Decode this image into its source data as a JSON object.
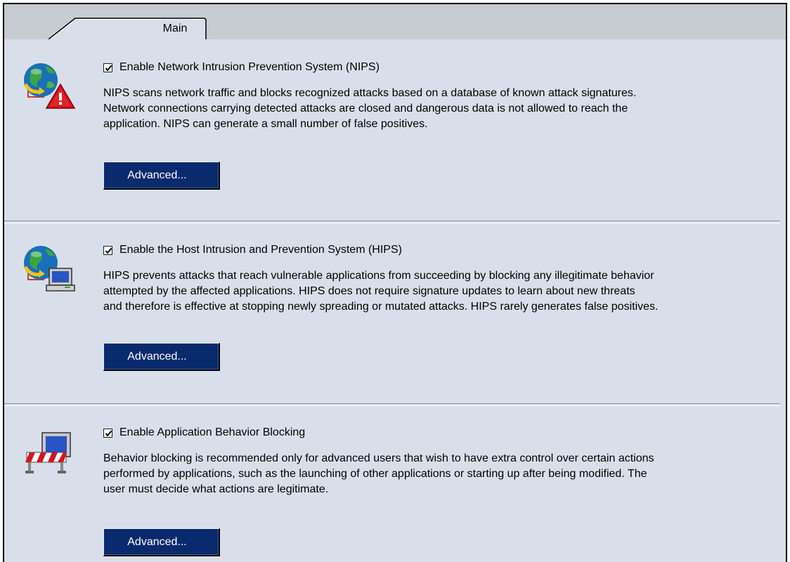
{
  "tabs": [
    {
      "label": "Main",
      "active": true
    }
  ],
  "sections": [
    {
      "id": "nips",
      "icon": "globe-warning-icon",
      "checkbox_checked": true,
      "checkbox_label": "Enable Network Intrusion Prevention System (NIPS)",
      "description_lines": [
        "NIPS scans network traffic and blocks recognized attacks based on a database of known attack signatures.",
        "Network connections carrying detected attacks are closed and dangerous data is not allowed to reach the",
        "application. NIPS can generate a small number of false positives."
      ],
      "button_label": "Advanced..."
    },
    {
      "id": "hips",
      "icon": "globe-computer-icon",
      "checkbox_checked": true,
      "checkbox_label": "Enable the Host Intrusion and Prevention System (HIPS)",
      "description_lines": [
        "HIPS prevents attacks that reach vulnerable applications from succeeding by blocking any illegitimate behavior",
        "attempted by the affected applications. HIPS does not require signature updates to learn about new threats",
        "and therefore is effective at stopping newly spreading or mutated attacks. HIPS rarely generates false positives."
      ],
      "button_label": "Advanced..."
    },
    {
      "id": "behavior",
      "icon": "computer-barrier-icon",
      "checkbox_checked": true,
      "checkbox_label": "Enable Application Behavior Blocking",
      "description_lines": [
        "Behavior blocking is recommended only for advanced users that wish to have extra control over certain actions",
        "performed by applications, such as the launching of other applications or starting up after being modified. The",
        "user must decide what actions are legitimate."
      ],
      "button_label": "Advanced..."
    }
  ],
  "colors": {
    "panel_background": "#d8dfea",
    "button_background": "#0a2a6e",
    "tabbar_background": "#c7ccd3"
  }
}
